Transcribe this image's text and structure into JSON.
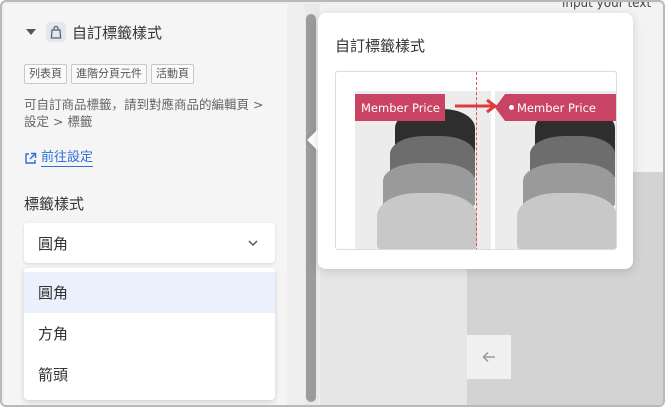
{
  "panel": {
    "title": "自訂標籤樣式",
    "tags": [
      "列表頁",
      "進階分頁元件",
      "活動頁"
    ],
    "description": "可自訂商品標籤，請到對應商品的編輯頁 > 設定 > 標籤",
    "settings_link": "前往設定",
    "style_label": "標籤樣式",
    "select_value": "圓角",
    "options": [
      "圓角",
      "方角",
      "箭頭"
    ]
  },
  "popover": {
    "title": "自訂標籤樣式",
    "badge_left": "Member Price",
    "badge_right": "Member Price"
  },
  "right": {
    "input_hint": "input your text"
  },
  "colors": {
    "accent_link": "#2f6fd9",
    "badge": "#c94464",
    "selected_option": "#eaf0fc"
  }
}
